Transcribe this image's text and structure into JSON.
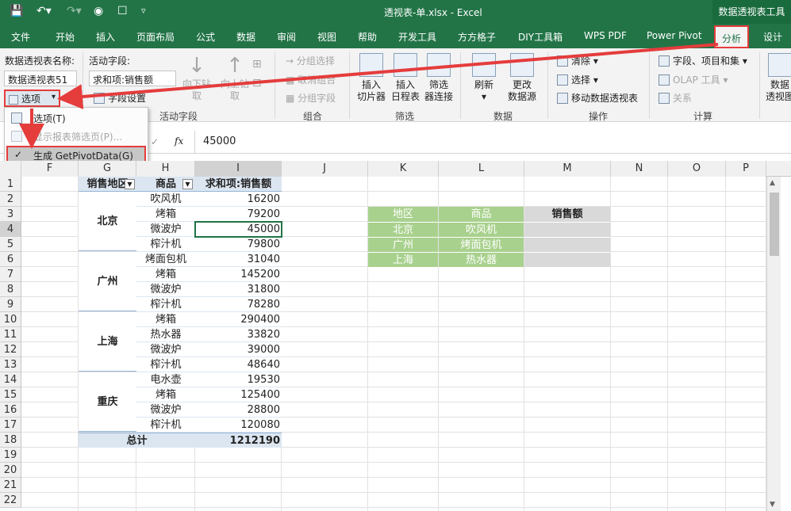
{
  "titlebar": {
    "document_title": "透视表-单.xlsx  -  Excel",
    "context_label": "数据透视表工具"
  },
  "tabs": [
    "文件",
    "开始",
    "插入",
    "页面布局",
    "公式",
    "数据",
    "审阅",
    "视图",
    "帮助",
    "开发工具",
    "方方格子",
    "DIY工具箱",
    "WPS PDF",
    "Power Pivot",
    "分析",
    "设计"
  ],
  "active_tab": "分析",
  "ribbon": {
    "pt_name_label": "数据透视表名称:",
    "pt_name_value": "数据透视表51",
    "options_button": "选项",
    "active_field_label": "活动字段:",
    "active_field_value": "求和项:销售额",
    "field_settings": "字段设置",
    "drill_down": "向下钻取",
    "drill_up": "向上钻取",
    "group_active_field": "活动字段",
    "group_selection": "分组选择",
    "ungroup": "取消组合",
    "group_field": "分组字段",
    "group_group": "组合",
    "insert_slicer": [
      "插入",
      "切片器"
    ],
    "insert_timeline": [
      "插入",
      "日程表"
    ],
    "filter_connections": [
      "筛选",
      "器连接"
    ],
    "group_filter": "筛选",
    "refresh": "刷新",
    "change_source": [
      "更改",
      "数据源"
    ],
    "group_data": "数据",
    "clear": "清除",
    "select": "选择",
    "move_pivot": "移动数据透视表",
    "group_actions": "操作",
    "fields_items": "字段、项目和集",
    "olap_tools": "OLAP 工具",
    "relationships": "关系",
    "group_calc": "计算",
    "pivotchart": [
      "数据",
      "透视图"
    ]
  },
  "dropdown": {
    "items": [
      "选项(T)",
      "显示报表筛选页(P)...",
      "生成 GetPivotData(G)"
    ],
    "checked": "生成 GetPivotData(G)"
  },
  "formula_bar": {
    "fx": "fx",
    "value": "45000"
  },
  "columns": [
    "F",
    "G",
    "H",
    "I",
    "J",
    "K",
    "L",
    "M",
    "N",
    "O",
    "P"
  ],
  "rows": [
    "1",
    "2",
    "3",
    "4",
    "5",
    "6",
    "7",
    "8",
    "9",
    "10",
    "11",
    "12",
    "13",
    "14",
    "15",
    "16",
    "17",
    "18",
    "19",
    "20",
    "21",
    "22"
  ],
  "pivot": {
    "headers": [
      "销售地区",
      "商品",
      "求和项:销售额"
    ],
    "regions": [
      "北京",
      "广州",
      "上海",
      "重庆"
    ],
    "rows": [
      [
        "吹风机",
        "16200"
      ],
      [
        "烤箱",
        "79200"
      ],
      [
        "微波炉",
        "45000"
      ],
      [
        "榨汁机",
        "79800"
      ],
      [
        "烤面包机",
        "31040"
      ],
      [
        "烤箱",
        "145200"
      ],
      [
        "微波炉",
        "31800"
      ],
      [
        "榨汁机",
        "78280"
      ],
      [
        "烤箱",
        "290400"
      ],
      [
        "热水器",
        "33820"
      ],
      [
        "微波炉",
        "39000"
      ],
      [
        "榨汁机",
        "48640"
      ],
      [
        "电水壶",
        "19530"
      ],
      [
        "烤箱",
        "125400"
      ],
      [
        "微波炉",
        "28800"
      ],
      [
        "榨汁机",
        "120080"
      ]
    ],
    "total_label": "总计",
    "total_value": "1212190"
  },
  "lookup": {
    "headers": [
      "地区",
      "商品",
      "销售额"
    ],
    "rows": [
      [
        "北京",
        "吹风机",
        ""
      ],
      [
        "广州",
        "烤面包机",
        ""
      ],
      [
        "上海",
        "热水器",
        ""
      ]
    ]
  },
  "colors": {
    "excel_green": "#227447",
    "header_green": "#a9d18e",
    "pivot_header": "#dce6f1",
    "highlight_red": "#e53c3c",
    "selected_cell": "#217346"
  }
}
